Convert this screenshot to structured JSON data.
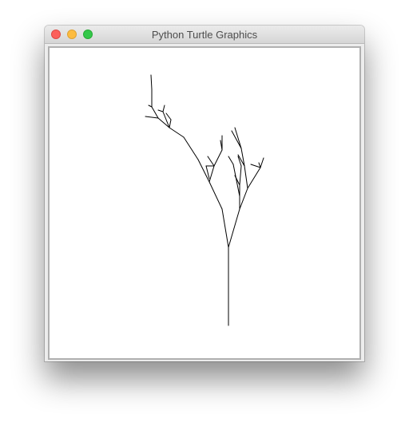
{
  "window": {
    "title": "Python Turtle Graphics",
    "buttons": {
      "close": "close-button",
      "minimize": "minimize-button",
      "zoom": "zoom-button"
    }
  },
  "canvas": {
    "background": "#ffffff",
    "pen_color": "#000000",
    "drawing": "fractal-tree"
  }
}
